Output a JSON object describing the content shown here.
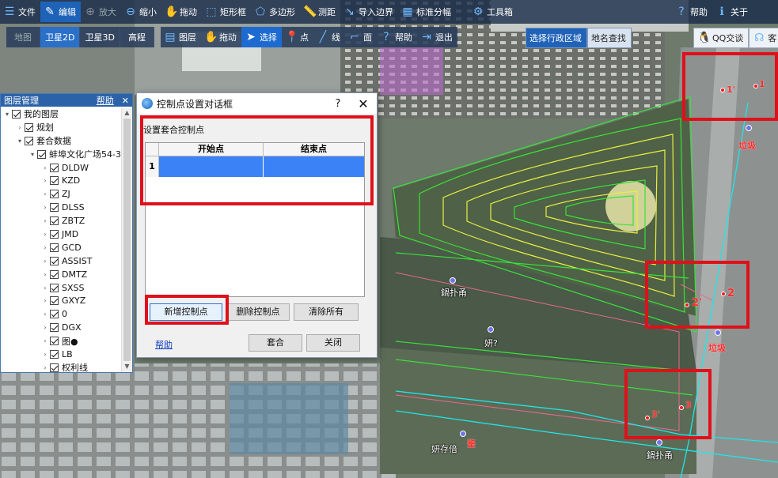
{
  "toolbar_main": {
    "file": "文件",
    "edit": "编辑",
    "enlarge": "放大",
    "shrink": "缩小",
    "pan": "拖动",
    "rect_select": "矩形框",
    "polygon": "多边形",
    "measure": "测距",
    "import_boundary": "导入边界",
    "std_sheet": "标准分幅",
    "toolbox": "工具箱",
    "help": "帮助",
    "about": "关于"
  },
  "toolbar_view": {
    "map": "地图",
    "sat2d": "卫星2D",
    "sat3d": "卫星3D",
    "elevation": "高程",
    "layers": "图层",
    "pan": "拖动",
    "select": "选择",
    "point": "点",
    "line": "线",
    "area": "面",
    "help": "帮助",
    "exit": "退出",
    "select_region": "选择行政区域",
    "place_search": "地名查找",
    "qq": "QQ交谈",
    "more": "客"
  },
  "layer_panel": {
    "title": "图层管理",
    "help": "帮助",
    "close": "✕",
    "items": [
      {
        "label": "我的图层",
        "level": 0,
        "arrow": "▾"
      },
      {
        "label": "规划",
        "level": 1,
        "arrow": "›"
      },
      {
        "label": "套合数据",
        "level": 1,
        "arrow": "▾"
      },
      {
        "label": "蚌埠文化广场54-3",
        "level": 2,
        "arrow": "▾"
      },
      {
        "label": "DLDW",
        "level": 3,
        "arrow": "›"
      },
      {
        "label": "KZD",
        "level": 3,
        "arrow": "›"
      },
      {
        "label": "ZJ",
        "level": 3,
        "arrow": "›"
      },
      {
        "label": "DLSS",
        "level": 3,
        "arrow": "›"
      },
      {
        "label": "ZBTZ",
        "level": 3,
        "arrow": "›"
      },
      {
        "label": "JMD",
        "level": 3,
        "arrow": "›"
      },
      {
        "label": "GCD",
        "level": 3,
        "arrow": "›"
      },
      {
        "label": "ASSIST",
        "level": 3,
        "arrow": "›"
      },
      {
        "label": "DMTZ",
        "level": 3,
        "arrow": "›"
      },
      {
        "label": "SXSS",
        "level": 3,
        "arrow": "›"
      },
      {
        "label": "GXYZ",
        "level": 3,
        "arrow": "›"
      },
      {
        "label": "0",
        "level": 3,
        "arrow": "›"
      },
      {
        "label": "DGX",
        "level": 3,
        "arrow": "›"
      },
      {
        "label": "图●",
        "level": 3,
        "arrow": "›"
      },
      {
        "label": "LB",
        "level": 3,
        "arrow": "›"
      },
      {
        "label": "权利线",
        "level": 3,
        "arrow": "›"
      }
    ]
  },
  "dialog": {
    "title": "控制点设置对话框",
    "question": "?",
    "close": "✕",
    "group_label": "设置套合控制点",
    "col_start": "开始点",
    "col_end": "结束点",
    "row1_index": "1",
    "btn_add": "新增控制点",
    "btn_delete": "删除控制点",
    "btn_clear": "清除所有",
    "help_link": "帮助",
    "btn_fit": "套合",
    "btn_close": "关闭"
  },
  "map_labels": {
    "l1": "鍋扑甬",
    "l2": "妍?",
    "l3": "鍋扑甬",
    "l4": "妍存偣",
    "red1": "1'",
    "red2": "1",
    "red3": "2'",
    "red4": "2",
    "red5": "3'",
    "red6": "3",
    "red7": "垃圾",
    "red8": "垃圾",
    "red9": "鉴"
  },
  "colors": {
    "highlight": "#e0101a",
    "contour_green": "#39e23a",
    "contour_yellow": "#e8f042",
    "boundary_cyan": "#1fe6e8",
    "boundary_pink": "#e86a8a",
    "selection_blue": "#3b82f6"
  }
}
